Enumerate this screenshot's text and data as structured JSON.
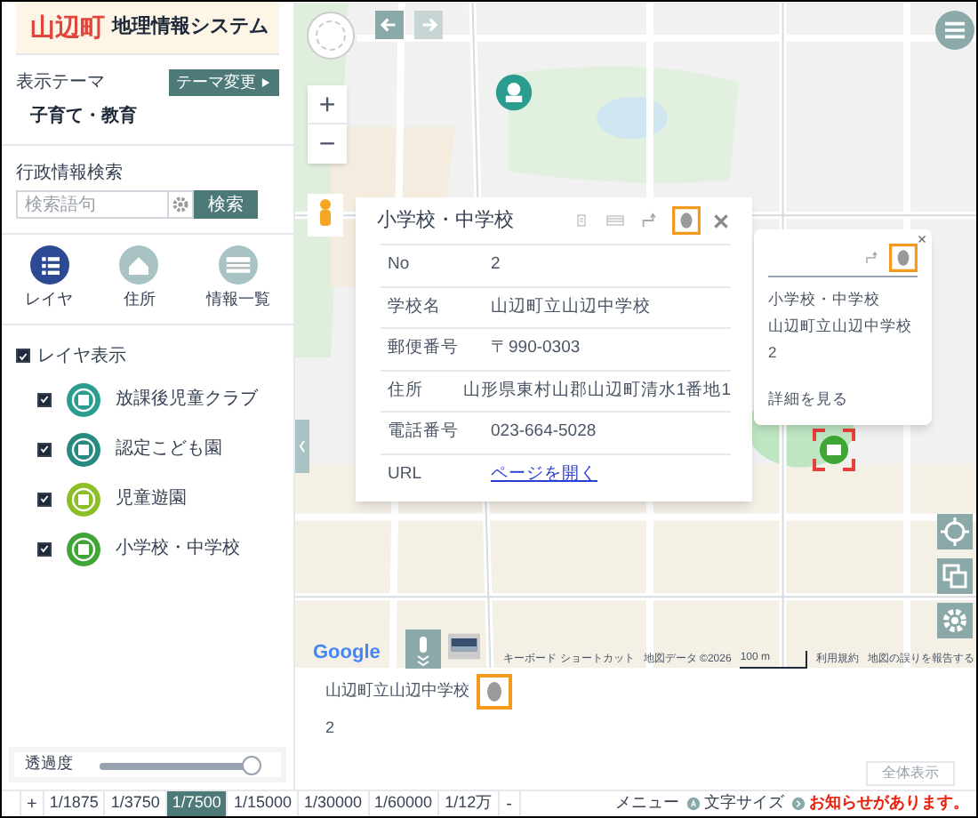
{
  "header": {
    "town": "山辺町",
    "title": "地理情報システム"
  },
  "theme": {
    "label": "表示テーマ",
    "value": "子育て・教育",
    "button": "テーマ変更"
  },
  "search": {
    "label": "行政情報検索",
    "placeholder": "検索語句",
    "button": "検索"
  },
  "nav": [
    {
      "label": "レイヤ",
      "kind": "layers",
      "selected": true
    },
    {
      "label": "住所",
      "kind": "home",
      "selected": false
    },
    {
      "label": "情報一覧",
      "kind": "list",
      "selected": false
    }
  ],
  "layers": {
    "label": "レイヤ表示",
    "checked": true,
    "items": [
      {
        "label": "放課後児童クラブ",
        "checked": true,
        "color": "#2a9d8f"
      },
      {
        "label": "認定こども園",
        "checked": true,
        "color": "#268a80"
      },
      {
        "label": "児童遊園",
        "checked": true,
        "color": "#8cbf26"
      },
      {
        "label": "小学校・中学校",
        "checked": true,
        "color": "#3fa535"
      }
    ]
  },
  "transparency": {
    "label": "透過度",
    "level": 1
  },
  "map_controls": {
    "zoom_in": "+",
    "zoom_out": "−"
  },
  "popup": {
    "title": "小学校・中学校",
    "rows": [
      {
        "label": "No",
        "value": "2",
        "kind": "text"
      },
      {
        "label": "学校名",
        "value": "山辺町立山辺中学校",
        "kind": "text"
      },
      {
        "label": "郵便番号",
        "value": "〒990-0303",
        "kind": "text"
      },
      {
        "label": "住所",
        "value": "山形県東村山郡山辺町清水1番地1",
        "kind": "text"
      },
      {
        "label": "電話番号",
        "value": "023-664-5028",
        "kind": "text"
      },
      {
        "label": "URL",
        "value": "ページを開く",
        "kind": "link"
      }
    ]
  },
  "tooltip": {
    "title": "小学校・中学校",
    "name": "山辺町立山辺中学校",
    "number": "2",
    "link": "詳細を見る"
  },
  "attribution": {
    "logo": "Google",
    "items": [
      "キーボード ショートカット",
      "地図データ ©2026",
      "100 m",
      "利用規約",
      "地図の誤りを報告する"
    ]
  },
  "result": {
    "name": "山辺町立山辺中学校",
    "number": "2"
  },
  "overview_button": {
    "label": "全体表示",
    "disabled": true
  },
  "scale_bar": {
    "zoom_in": "+",
    "zoom_out": "-",
    "scales": [
      {
        "label": "1/1875",
        "selected": false
      },
      {
        "label": "1/3750",
        "selected": false
      },
      {
        "label": "1/7500",
        "selected": true
      },
      {
        "label": "1/15000",
        "selected": false
      },
      {
        "label": "1/30000",
        "selected": false
      },
      {
        "label": "1/60000",
        "selected": false
      },
      {
        "label": "1/12万",
        "selected": false
      }
    ]
  },
  "footer_links": [
    {
      "label": "メニュー",
      "kind": "plain"
    },
    {
      "label": "文字サイズ",
      "kind": "font"
    },
    {
      "label": "お知らせがあります。",
      "kind": "notice"
    }
  ]
}
